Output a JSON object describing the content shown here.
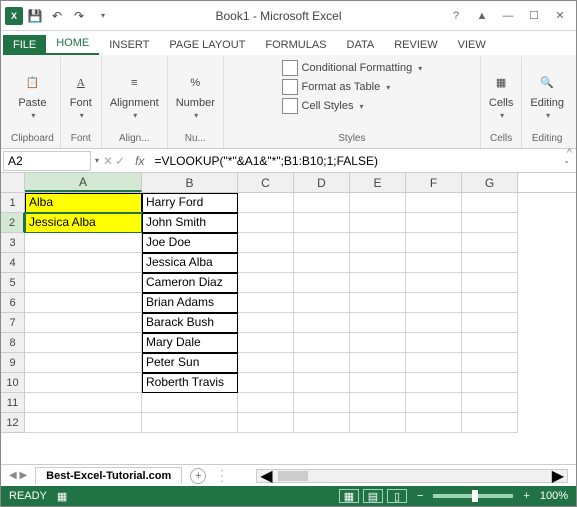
{
  "title": "Book1 - Microsoft Excel",
  "qat": {
    "save": "💾",
    "undo": "↶",
    "redo": "↷"
  },
  "wincontrols": {
    "help": "?",
    "ribbon": "▲",
    "min": "—",
    "max": "☐",
    "close": "✕"
  },
  "tabs": [
    "FILE",
    "HOME",
    "INSERT",
    "PAGE LAYOUT",
    "FORMULAS",
    "DATA",
    "REVIEW",
    "VIEW"
  ],
  "ribbon": {
    "clipboard": {
      "paste": "Paste",
      "label": "Clipboard"
    },
    "font": {
      "btn": "Font",
      "label": "Font"
    },
    "alignment": {
      "btn": "Alignment",
      "label": "Align..."
    },
    "number": {
      "btn": "Number",
      "label": "Nu..."
    },
    "styles": {
      "cond": "Conditional Formatting",
      "table": "Format as Table",
      "cell": "Cell Styles",
      "label": "Styles"
    },
    "cells": {
      "btn": "Cells",
      "label": "Cells"
    },
    "editing": {
      "btn": "Editing",
      "label": "Editing"
    }
  },
  "namebox": "A2",
  "formula": "=VLOOKUP(\"*\"&A1&\"*\";B1:B10;1;FALSE)",
  "columns": [
    "A",
    "B",
    "C",
    "D",
    "E",
    "F",
    "G"
  ],
  "cells": {
    "A1": "Alba",
    "A2": "Jessica Alba",
    "B1": "Harry Ford",
    "B2": "John Smith",
    "B3": "Joe Doe",
    "B4": "Jessica Alba",
    "B5": "Cameron Diaz",
    "B6": "Brian Adams",
    "B7": "Barack Bush",
    "B8": "Mary Dale",
    "B9": "Peter Sun",
    "B10": "Roberth Travis"
  },
  "sheet": "Best-Excel-Tutorial.com",
  "status": "READY",
  "zoom": "100%"
}
